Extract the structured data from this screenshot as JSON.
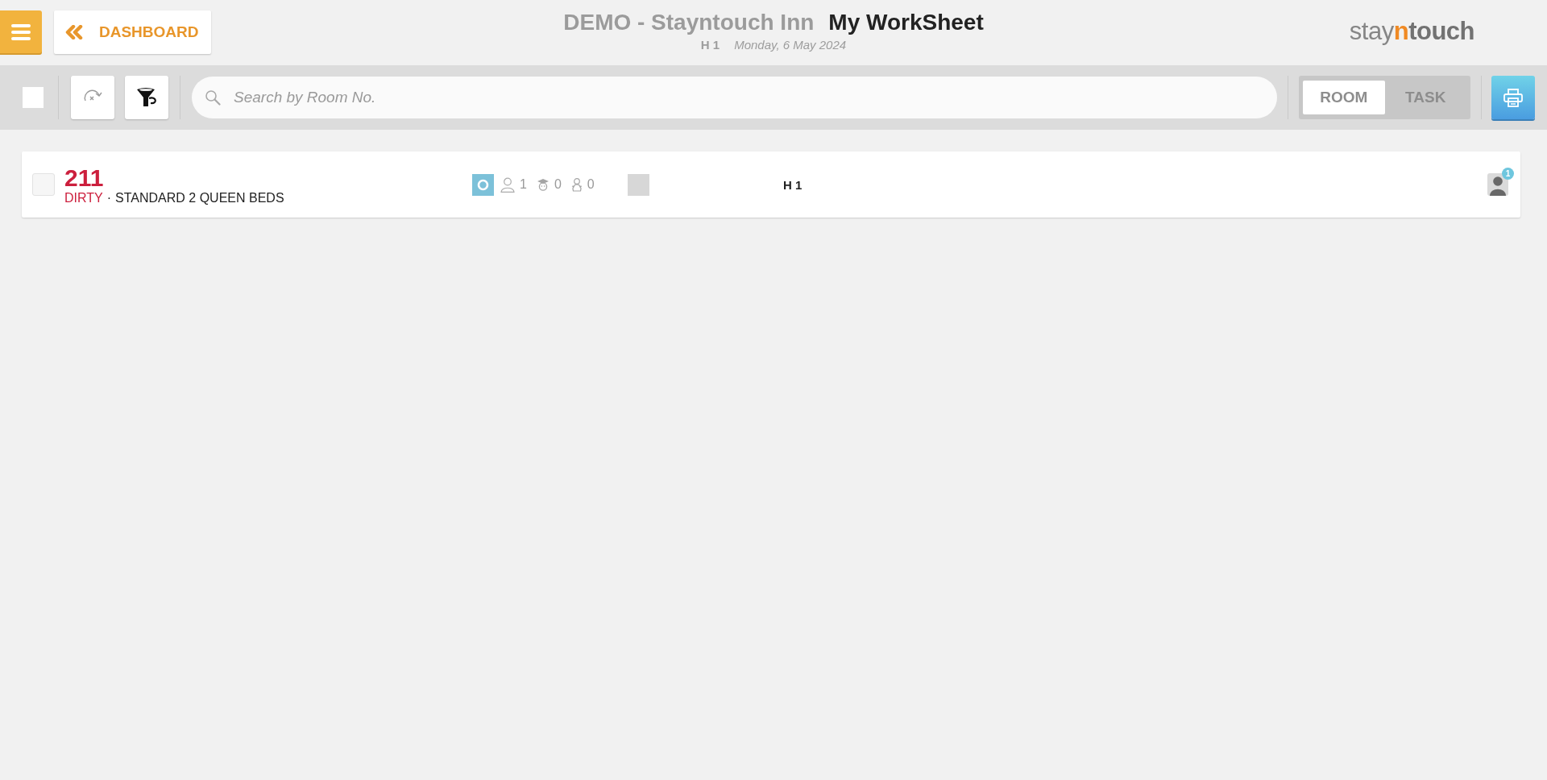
{
  "header": {
    "back_button": {
      "label": "DASHBOARD"
    },
    "title": {
      "hotel": "DEMO - Stayntouch Inn",
      "page": "My WorkSheet"
    },
    "subtitle": {
      "floor": "H 1",
      "date": "Monday, 6 May 2024"
    },
    "logo": [
      {
        "text": "stay",
        "kind": "light"
      },
      {
        "text": "n",
        "kind": "accent"
      },
      {
        "text": "touch",
        "kind": "bold"
      }
    ]
  },
  "toolbar": {
    "select_all": {
      "checked": false
    },
    "search": {
      "placeholder": "Search by Room No."
    },
    "view_tabs": [
      {
        "label": "ROOM",
        "selected": true
      },
      {
        "label": "TASK",
        "selected": false
      }
    ]
  },
  "rooms": [
    {
      "checked": false,
      "number": "211",
      "color": "#cc1f3d",
      "status": "DIRTY",
      "separator": "·",
      "type": "STANDARD 2 QUEEN BEDS",
      "guests": [
        {
          "kind": "adult",
          "count": "1"
        },
        {
          "kind": "child",
          "count": "0"
        },
        {
          "kind": "infant",
          "count": "0"
        }
      ],
      "floor": "H 1",
      "assignee_badge": "1"
    }
  ]
}
